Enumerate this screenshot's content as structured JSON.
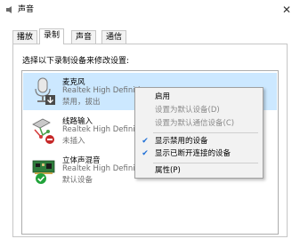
{
  "window": {
    "title": "声音",
    "close_glyph": "✕"
  },
  "tabs": [
    {
      "label": "播放",
      "active": false
    },
    {
      "label": "录制",
      "active": true
    },
    {
      "label": "声音",
      "active": false
    },
    {
      "label": "通信",
      "active": false
    }
  ],
  "panel": {
    "instruction": "选择以下录制设备来修改设置:"
  },
  "devices": [
    {
      "name": "麦克风",
      "driver": "Realtek High Definitio",
      "status": "禁用，拔出",
      "icon": "microphone-icon",
      "badge": "down-arrow-badge",
      "selected": true
    },
    {
      "name": "线路输入",
      "driver": "Realtek High Definitio",
      "status": "未插入",
      "icon": "line-in-icon",
      "badge": "red-dot-badge",
      "selected": false
    },
    {
      "name": "立体声混音",
      "driver": "Realtek High Definitio",
      "status": "默认设备",
      "icon": "sound-card-icon",
      "badge": "green-check-badge",
      "selected": false
    }
  ],
  "context_menu": {
    "items": [
      {
        "label": "启用",
        "enabled": true,
        "checked": false
      },
      {
        "label": "设置为默认设备(D)",
        "enabled": false,
        "checked": false
      },
      {
        "label": "设置为默认通信设备(C)",
        "enabled": false,
        "checked": false
      },
      {
        "label": "显示禁用的设备",
        "enabled": true,
        "checked": true
      },
      {
        "label": "显示已断开连接的设备",
        "enabled": true,
        "checked": true
      },
      {
        "label": "属性(P)",
        "enabled": true,
        "checked": false
      }
    ],
    "check_glyph": "✔"
  },
  "colors": {
    "selection": "#cce8ff",
    "check": "#1e6fd6",
    "menu_bg": "#f2f2f2"
  }
}
